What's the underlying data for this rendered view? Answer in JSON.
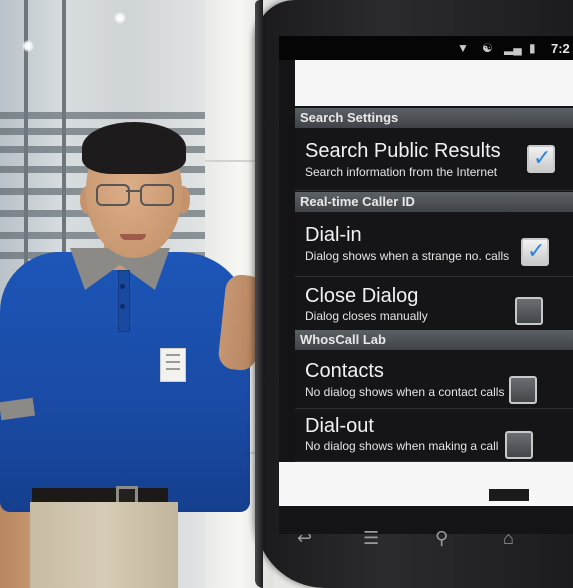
{
  "status_bar": {
    "time": "7:2",
    "icons": [
      "mute-icon",
      "usb-icon",
      "signal-icon",
      "battery-icon"
    ]
  },
  "settings": {
    "sections": [
      {
        "header": "Search Settings",
        "items": [
          {
            "title": "Search Public Results",
            "description": "Search information from the Internet",
            "checked": true
          }
        ]
      },
      {
        "header": "Real-time Caller ID",
        "items": [
          {
            "title": "Dial-in",
            "description": "Dialog shows when a strange no. calls",
            "checked": true
          },
          {
            "title": "Close Dialog",
            "description": "Dialog closes manually",
            "checked": false
          }
        ]
      },
      {
        "header": "WhosCall Lab",
        "items": [
          {
            "title": "Contacts",
            "description": "No dialog shows when a contact calls",
            "checked": false
          },
          {
            "title": "Dial-out",
            "description": "No dialog shows when making a call",
            "checked": false
          }
        ]
      }
    ]
  },
  "nav_icons": [
    "back-icon",
    "menu-icon",
    "search-icon",
    "home-icon"
  ],
  "colors": {
    "shirt": "#1d56b8",
    "screen_bg": "#141416",
    "section_header": "#4c5055",
    "checkmark": "#2a86e0"
  }
}
